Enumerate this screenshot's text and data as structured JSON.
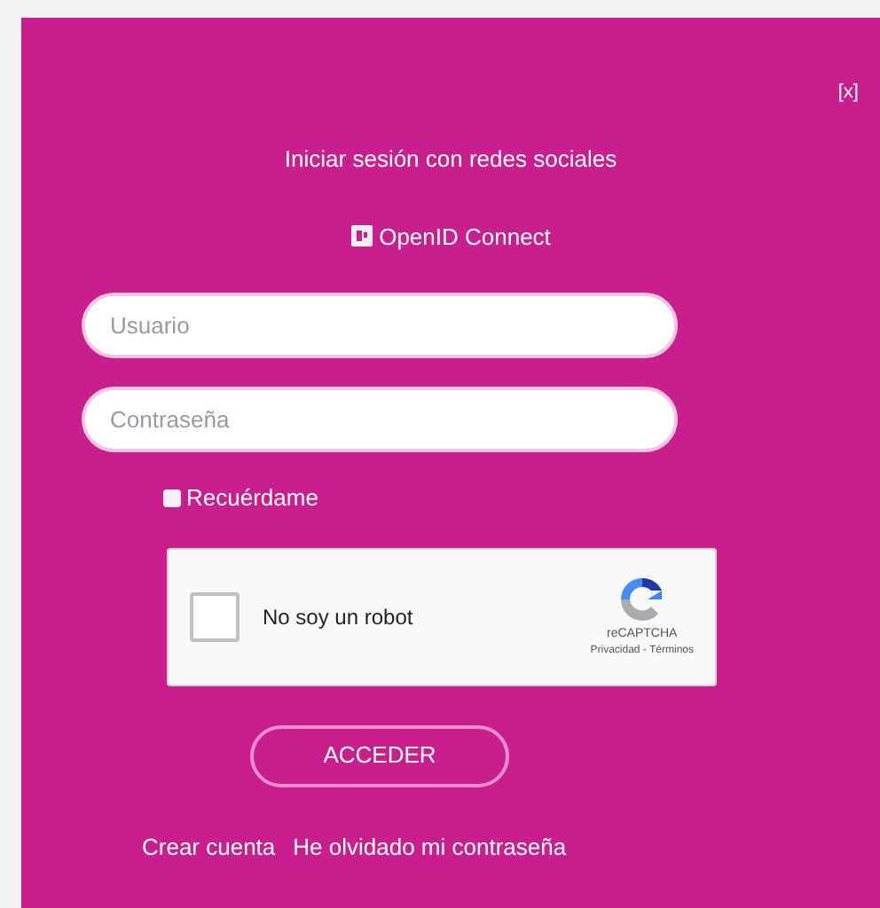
{
  "close": "[x]",
  "social_title": "Iniciar sesión con redes sociales",
  "social_providers": [
    {
      "label": "OpenID Connect"
    }
  ],
  "fields": [
    {
      "placeholder": "Usuario"
    },
    {
      "placeholder": "Contraseña"
    }
  ],
  "remember": {
    "label": "Recuérdame",
    "checked": false
  },
  "captcha": {
    "label": "No soy un robot",
    "checked": false,
    "brand": "reCAPTCHA",
    "links": "Privacidad - Términos"
  },
  "submit": "ACCEDER",
  "links": [
    "Crear cuenta",
    "He olvidado mi contraseña"
  ]
}
